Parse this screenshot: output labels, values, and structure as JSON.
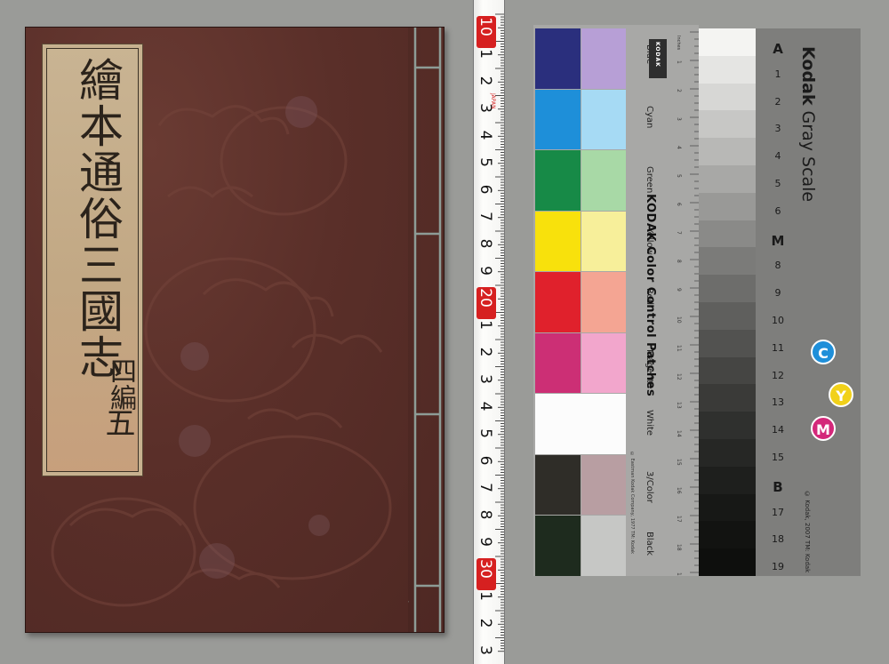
{
  "book": {
    "title_slip_text": "繪本通俗三國志",
    "volume_label": "四編",
    "volume_number": "五"
  },
  "ruler": {
    "numbers": [
      "10",
      "1",
      "2",
      "3",
      "4",
      "5",
      "6",
      "7",
      "8",
      "9",
      "20",
      "1",
      "2",
      "3",
      "4",
      "5",
      "6",
      "7",
      "8",
      "9",
      "30",
      "1",
      "2",
      "3"
    ],
    "boxed_numbers": [
      "10",
      "20",
      "30"
    ],
    "small_marking": "JAPAN",
    "accent_color": "#d62020"
  },
  "color_card": {
    "heading": "KODAK Color Control Patches",
    "logo_text": "KODAK",
    "copyright": "© Eastman Kodak Company, 1977 TM: Kodak",
    "inch_label": "Inches",
    "rows": [
      {
        "label": "Blue",
        "left": "#2a2f7d",
        "right": "#b79fd6"
      },
      {
        "label": "Cyan",
        "left": "#1e8fd9",
        "right": "#a6daf4"
      },
      {
        "label": "Green",
        "left": "#178a47",
        "right": "#a8d9a6"
      },
      {
        "label": "Yellow",
        "left": "#f8e10c",
        "right": "#f7ef9a"
      },
      {
        "label": "Red",
        "left": "#e0212c",
        "right": "#f4a593"
      },
      {
        "label": "Magenta",
        "left": "#cc2f75",
        "right": "#f2a6cc"
      },
      {
        "label": "White",
        "left": "#fcfcfc",
        "right": "#fcfcfc"
      },
      {
        "label": "3/Color",
        "left": "#2f2d28",
        "right": "#b89ea2"
      },
      {
        "label": "Black",
        "left": "#1e2b1e",
        "right": "#c6c7c5"
      }
    ]
  },
  "gray_scale": {
    "brand": "Kodak",
    "title": "Gray Scale",
    "copyright": "© Kodak, 2007 TM: Kodak",
    "cmy": [
      {
        "letter": "C",
        "color": "#1f8fd9"
      },
      {
        "letter": "Y",
        "color": "#f1d11a"
      },
      {
        "letter": "M",
        "color": "#d4287a"
      }
    ],
    "steps": [
      "A",
      "1",
      "2",
      "3",
      "4",
      "5",
      "6",
      "M",
      "8",
      "9",
      "10",
      "11",
      "12",
      "13",
      "14",
      "15",
      "B",
      "17",
      "18",
      "19"
    ],
    "step_colors": [
      "#f4f4f2",
      "#e5e5e3",
      "#d7d7d5",
      "#c7c7c5",
      "#b8b8b6",
      "#a8a8a6",
      "#999997",
      "#8a8a88",
      "#7b7b79",
      "#6d6d6b",
      "#5f5f5d",
      "#525250",
      "#454543",
      "#3a3a38",
      "#2f302e",
      "#262725",
      "#1e1f1d",
      "#171816",
      "#121311",
      "#0e0f0d"
    ]
  }
}
